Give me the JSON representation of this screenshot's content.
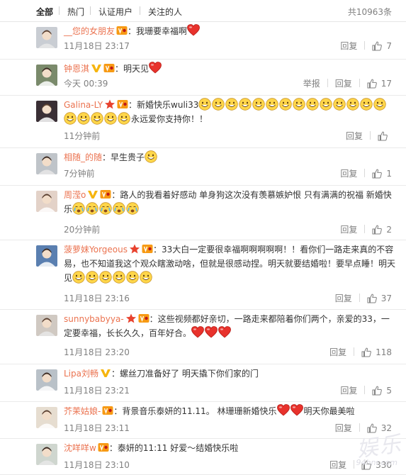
{
  "tabs": [
    "全部",
    "热门",
    "认证用户",
    "关注的人"
  ],
  "total": "共10963条",
  "actions": {
    "report": "举报",
    "reply": "回复"
  },
  "watermark": {
    "main": "娱乐",
    "sub": "94hnr.com"
  },
  "comments": [
    {
      "avatar_color": "#c9cdd3",
      "username": "__您的女朋友",
      "badges": [
        "vip-icon"
      ],
      "segments": [
        {
          "t": "text",
          "v": "：我珊要幸福啊"
        },
        {
          "t": "heart",
          "n": 1
        }
      ],
      "time": "11月18日 23:17",
      "report": false,
      "likes": "7"
    },
    {
      "avatar_color": "#7a8a6b",
      "username": "钟恩淇",
      "badges": [
        "verified-v-icon",
        "vip-icon"
      ],
      "segments": [
        {
          "t": "text",
          "v": "：明天见"
        },
        {
          "t": "heart",
          "n": 1
        }
      ],
      "time": "今天 00:39",
      "report": true,
      "likes": "17"
    },
    {
      "avatar_color": "#3a2f35",
      "username": "Galina-LY",
      "badges": [
        "star-icon",
        "vip-icon"
      ],
      "segments": [
        {
          "t": "text",
          "v": "：新婚快乐wuli33"
        },
        {
          "t": "face",
          "n": 19
        },
        {
          "t": "text",
          "v": "永远爱你支持你！！"
        }
      ],
      "time": "11分钟前",
      "report": false,
      "likes": ""
    },
    {
      "avatar_color": "#bfc4c9",
      "username": "相随_的随",
      "badges": [],
      "segments": [
        {
          "t": "text",
          "v": "：早生贵子"
        },
        {
          "t": "face",
          "n": 1
        }
      ],
      "time": "7分钟前",
      "report": false,
      "likes": "1"
    },
    {
      "avatar_color": "#e3d2c8",
      "username": "周滢o",
      "badges": [
        "verified-v-icon",
        "vip-icon"
      ],
      "segments": [
        {
          "t": "text",
          "v": "：路人的我看着好感动 单身狗这次没有羡慕嫉妒恨 只有满满的祝福 新婚快乐"
        },
        {
          "t": "cry",
          "n": 5
        }
      ],
      "time": "20分钟前",
      "report": false,
      "likes": "2"
    },
    {
      "avatar_color": "#5a7fb0",
      "username": "菠萝妹Yorgeous",
      "badges": [
        "star-icon",
        "vip-icon"
      ],
      "segments": [
        {
          "t": "text",
          "v": "：33大白一定要很幸福啊啊啊啊啊！！看你们一路走来真的不容易，也不知道我这个观众瞎激动啥，但就是很感动捏。明天就要结婚啦！要早点睡！明天见"
        },
        {
          "t": "face",
          "n": 6
        }
      ],
      "time": "11月18日 23:16",
      "report": false,
      "likes": "37"
    },
    {
      "avatar_color": "#d0c9c2",
      "username": "sunnybabyya-",
      "badges": [
        "star-icon",
        "vip-icon"
      ],
      "segments": [
        {
          "t": "text",
          "v": "：这些视频都好亲切，一路走来都陪着你们两个，亲爱的33，一定要幸福，长长久久，百年好合。"
        },
        {
          "t": "heart",
          "n": 3
        }
      ],
      "time": "11月18日 23:20",
      "report": false,
      "likes": "118"
    },
    {
      "avatar_color": "#b9c1c8",
      "username": "Lipa刘畅",
      "badges": [
        "verified-v-icon"
      ],
      "segments": [
        {
          "t": "text",
          "v": "：螺丝刀准备好了 明天撬下你们家的门"
        }
      ],
      "time": "11月18日 23:21",
      "report": false,
      "likes": "5"
    },
    {
      "avatar_color": "#e6ddd0",
      "username": "芥茉姑娘-",
      "badges": [
        "vip-icon"
      ],
      "segments": [
        {
          "t": "text",
          "v": "：背景音乐泰妍的11.11。 林珊珊新婚快乐"
        },
        {
          "t": "heart",
          "n": 2
        },
        {
          "t": "text",
          "v": "明天你最美啦"
        }
      ],
      "time": "11月18日 23:11",
      "report": false,
      "likes": "32"
    },
    {
      "avatar_color": "#cfd6cf",
      "username": "沈咩咩w",
      "badges": [
        "vip-icon"
      ],
      "segments": [
        {
          "t": "text",
          "v": "：泰妍的11:11 好爱～结婚快乐啦"
        }
      ],
      "time": "11月18日 23:10",
      "report": false,
      "likes": "330"
    }
  ]
}
